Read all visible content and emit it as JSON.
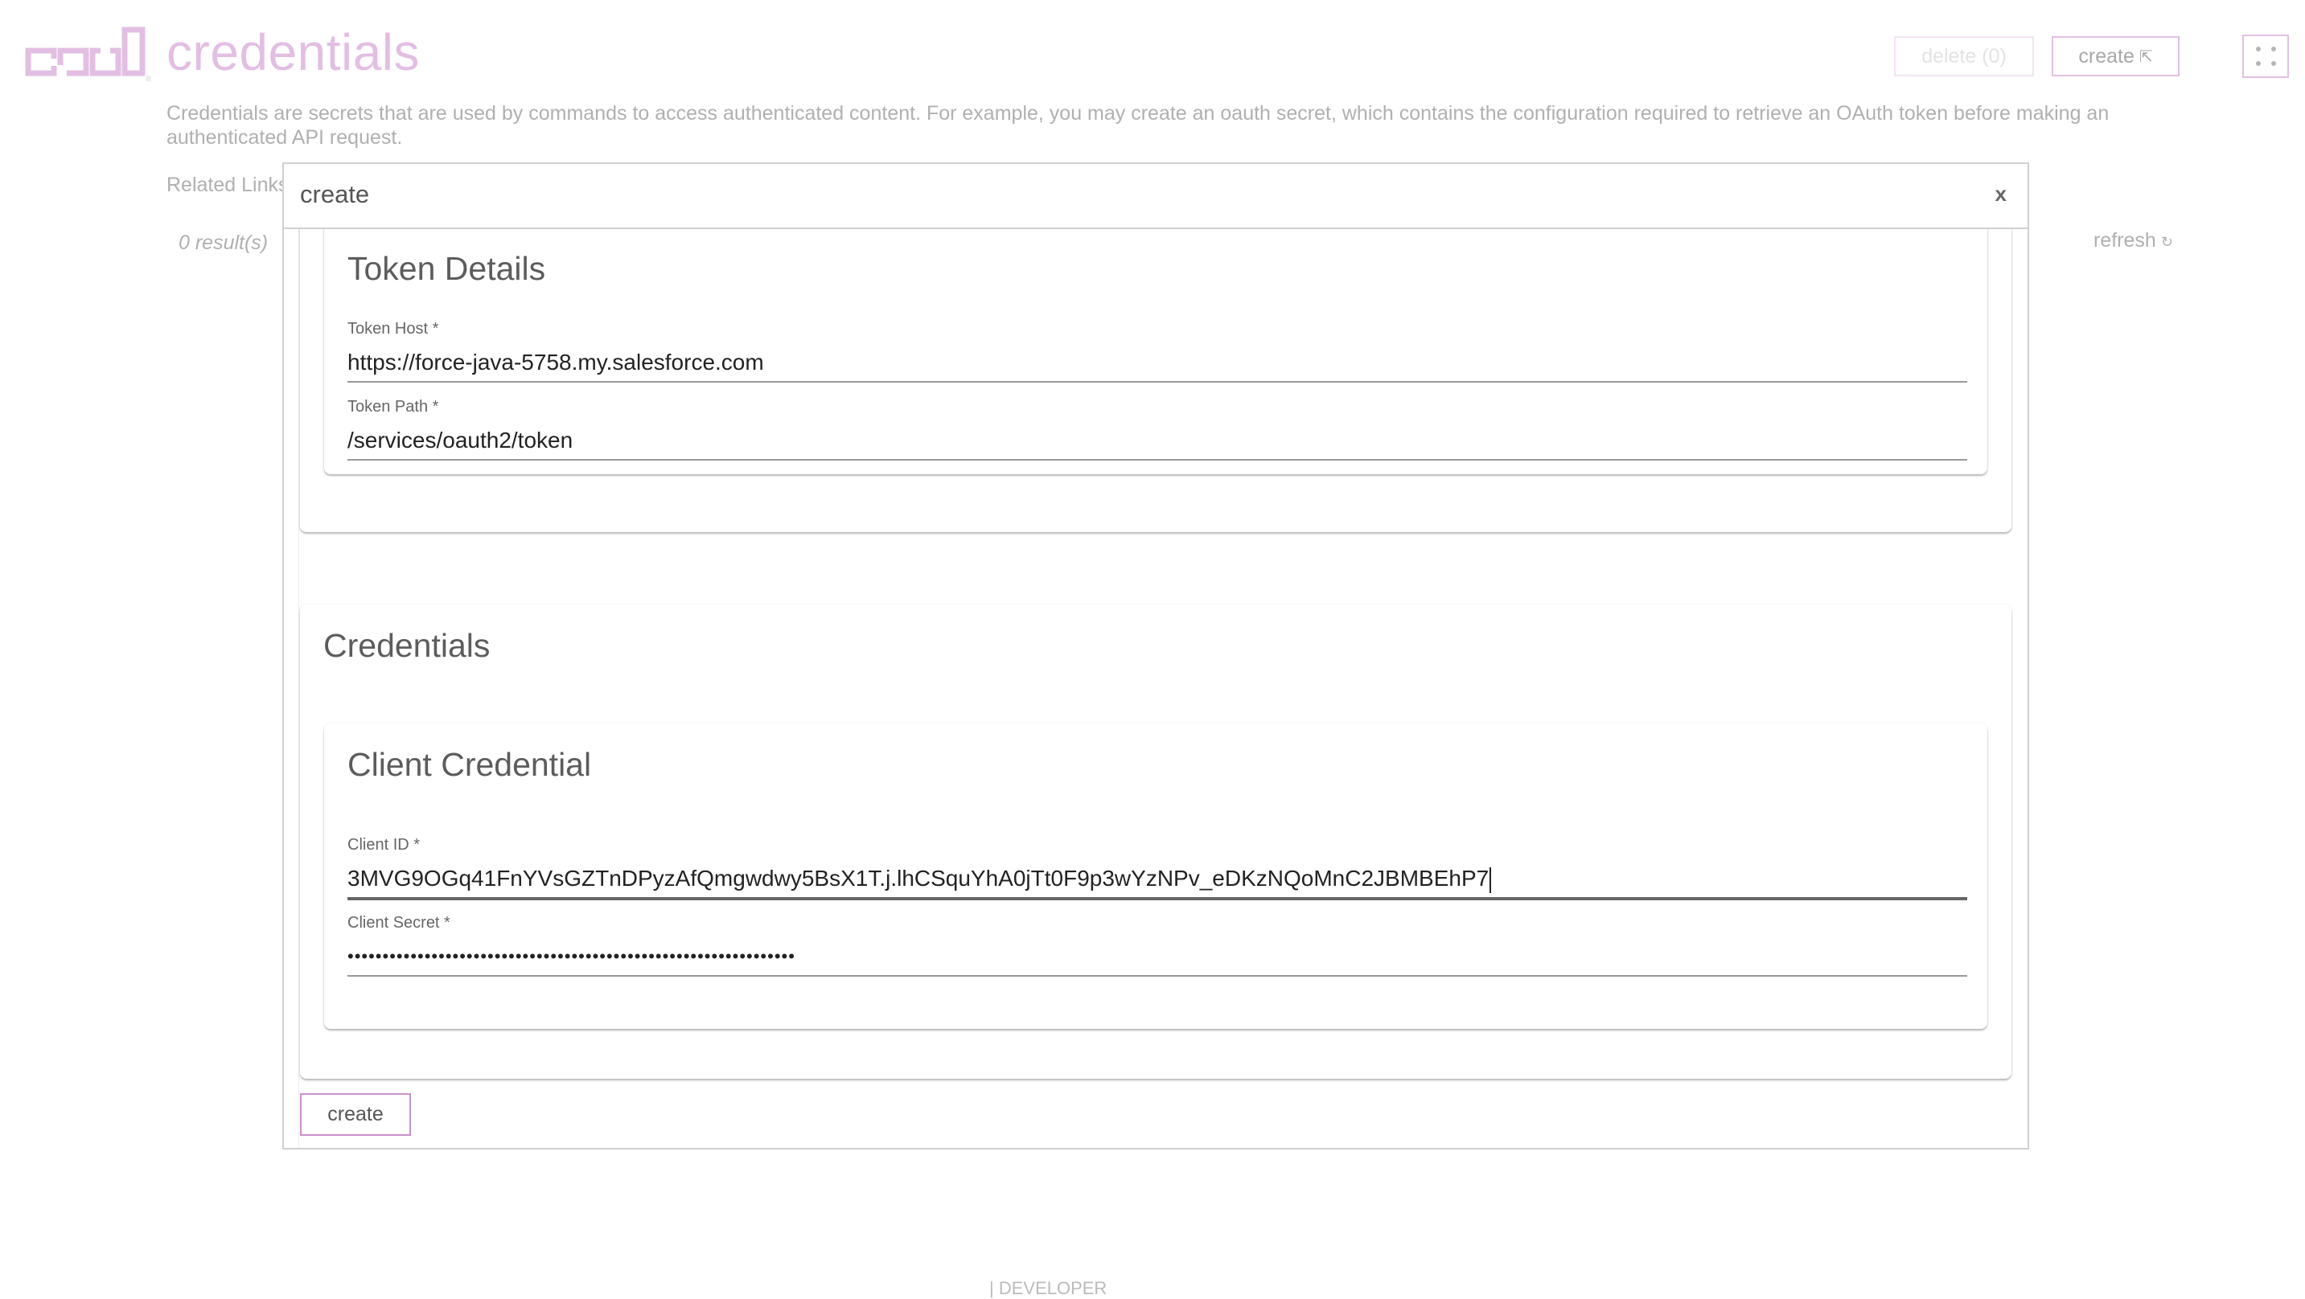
{
  "header": {
    "logo_text": "crul",
    "title": "credentials",
    "description": "Credentials are secrets that are used by commands to access authenticated content. For example, you may create an oauth secret, which contains the configuration required to retrieve an OAuth token before making an authenticated API request.",
    "related_links_label": "Related Links",
    "results_count": "0 result(s)",
    "refresh_label": "refresh",
    "refresh_icon": "↻",
    "delete_button": "delete (0)",
    "create_button": "create",
    "create_icon": "⇱",
    "fullscreen_icon": "fullscreen-icon"
  },
  "modal": {
    "title": "create",
    "close_label": "x",
    "sections": {
      "token_details": {
        "title": "Token Details",
        "fields": [
          {
            "label": "Token Host *",
            "value": "https://force-java-5758.my.salesforce.com"
          },
          {
            "label": "Token Path *",
            "value": "/services/oauth2/token"
          }
        ]
      },
      "credentials": {
        "title": "Credentials",
        "client_credential": {
          "title": "Client Credential",
          "fields": [
            {
              "label": "Client ID *",
              "value": "3MVG9OGq41FnYVsGZTnDPyzAfQmgwdwy5BsX1T.j.lhCSquYhA0jTt0F9p3wYzNPv_eDKzNQoMnC2JBMBEhP7"
            },
            {
              "label": "Client Secret *",
              "value": "••••••••••••••••••••••••••••••••••••••••••••••••••••••••••••••••"
            }
          ]
        }
      }
    },
    "submit_label": "create"
  },
  "footer": {
    "text": "| DEVELOPER"
  },
  "colors": {
    "brand": "#e2bfe2",
    "brand_border": "#c98fca",
    "muted_text": "#b0b0b0"
  }
}
